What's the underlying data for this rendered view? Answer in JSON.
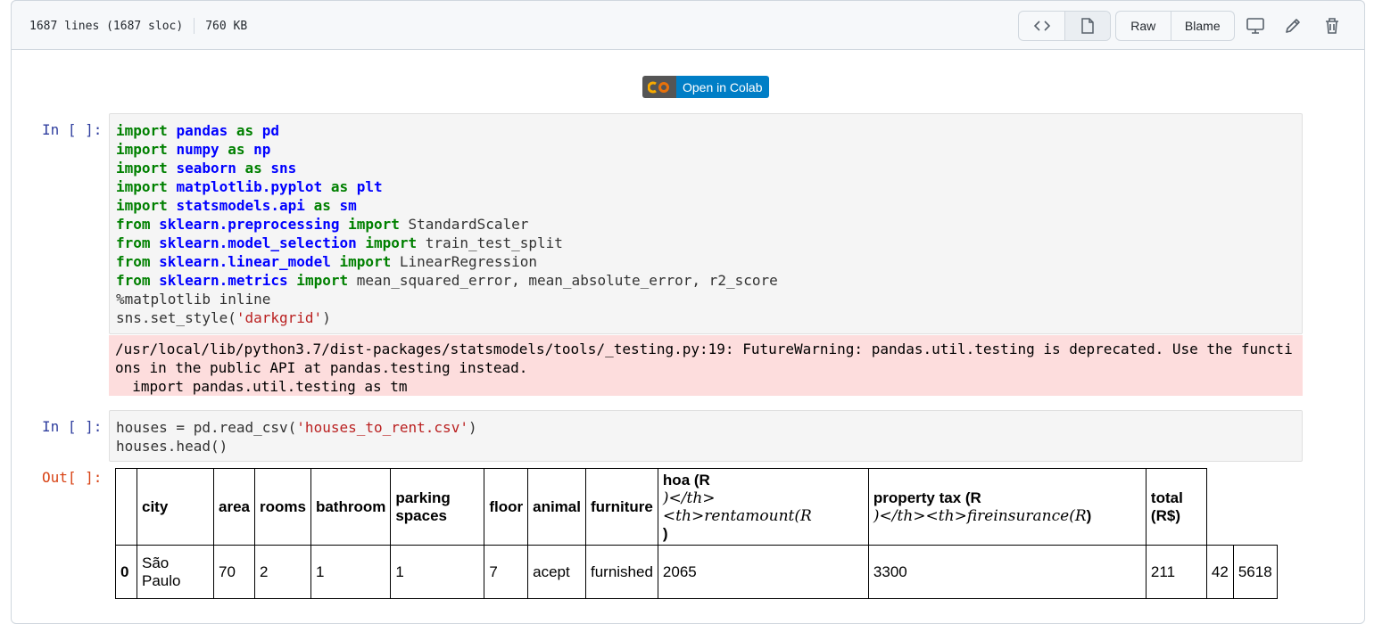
{
  "file_info": {
    "lines": "1687 lines (1687 sloc)",
    "size": "760 KB"
  },
  "toolbar": {
    "raw": "Raw",
    "blame": "Blame"
  },
  "colab_badge": {
    "text": "Open in Colab"
  },
  "cells": [
    {
      "prompt": "In [ ]:",
      "code_lines": [
        [
          [
            "kw",
            "import "
          ],
          [
            "mod",
            "pandas"
          ],
          [
            "kw",
            " as "
          ],
          [
            "mod",
            "pd"
          ]
        ],
        [
          [
            "kw",
            "import "
          ],
          [
            "mod",
            "numpy"
          ],
          [
            "kw",
            " as "
          ],
          [
            "mod",
            "np"
          ]
        ],
        [
          [
            "kw",
            "import "
          ],
          [
            "mod",
            "seaborn"
          ],
          [
            "kw",
            " as "
          ],
          [
            "mod",
            "sns"
          ]
        ],
        [
          [
            "kw",
            "import "
          ],
          [
            "mod",
            "matplotlib.pyplot"
          ],
          [
            "kw",
            " as "
          ],
          [
            "mod",
            "plt"
          ]
        ],
        [
          [
            "kw",
            "import "
          ],
          [
            "mod",
            "statsmodels.api"
          ],
          [
            "kw",
            " as "
          ],
          [
            "mod",
            "sm"
          ]
        ],
        [
          [
            "kw",
            "from "
          ],
          [
            "mod",
            "sklearn.preprocessing"
          ],
          [
            "kw",
            " import "
          ],
          [
            "",
            "StandardScaler"
          ]
        ],
        [
          [
            "kw",
            "from "
          ],
          [
            "mod",
            "sklearn.model_selection"
          ],
          [
            "kw",
            " import "
          ],
          [
            "",
            "train_test_split"
          ]
        ],
        [
          [
            "kw",
            "from "
          ],
          [
            "mod",
            "sklearn.linear_model"
          ],
          [
            "kw",
            " import "
          ],
          [
            "",
            "LinearRegression"
          ]
        ],
        [
          [
            "kw",
            "from "
          ],
          [
            "mod",
            "sklearn.metrics"
          ],
          [
            "kw",
            " import "
          ],
          [
            "",
            "mean_squared_error, mean_absolute_error, r2_score"
          ]
        ],
        [
          [
            "",
            "%matplotlib inline"
          ]
        ],
        [
          [
            "",
            "sns.set_style("
          ],
          [
            "str",
            "'darkgrid'"
          ],
          [
            "",
            ")"
          ]
        ]
      ],
      "stderr": "/usr/local/lib/python3.7/dist-packages/statsmodels/tools/_testing.py:19: FutureWarning: pandas.util.testing is deprecated. Use the functi\nons in the public API at pandas.testing instead.\n  import pandas.util.testing as tm"
    },
    {
      "prompt": "In [ ]:",
      "code_lines": [
        [
          [
            "",
            "houses = pd.read_csv("
          ],
          [
            "str",
            "'houses_to_rent.csv'"
          ],
          [
            "",
            ")"
          ]
        ],
        [
          [
            "",
            "houses.head()"
          ]
        ]
      ],
      "out_prompt": "Out[ ]:"
    }
  ],
  "dataframe": {
    "headers": [
      "",
      "city",
      "area",
      "rooms",
      "bathroom",
      "parking spaces",
      "floor",
      "animal",
      "furniture"
    ],
    "hoa_header": {
      "a": "hoa (R",
      "math": ")</th><th>rentamount(R",
      "b": ")"
    },
    "tax_header": {
      "a": "property tax (R",
      "math": ")</th><th>fireinsurance(R",
      "b": ")"
    },
    "total_header": "total (R$)",
    "rows": [
      {
        "index": "0",
        "cells": [
          "São Paulo",
          "70",
          "2",
          "1",
          "1",
          "7",
          "acept",
          "furnished",
          "2065",
          "3300",
          "211",
          "42",
          "5618"
        ]
      }
    ]
  }
}
